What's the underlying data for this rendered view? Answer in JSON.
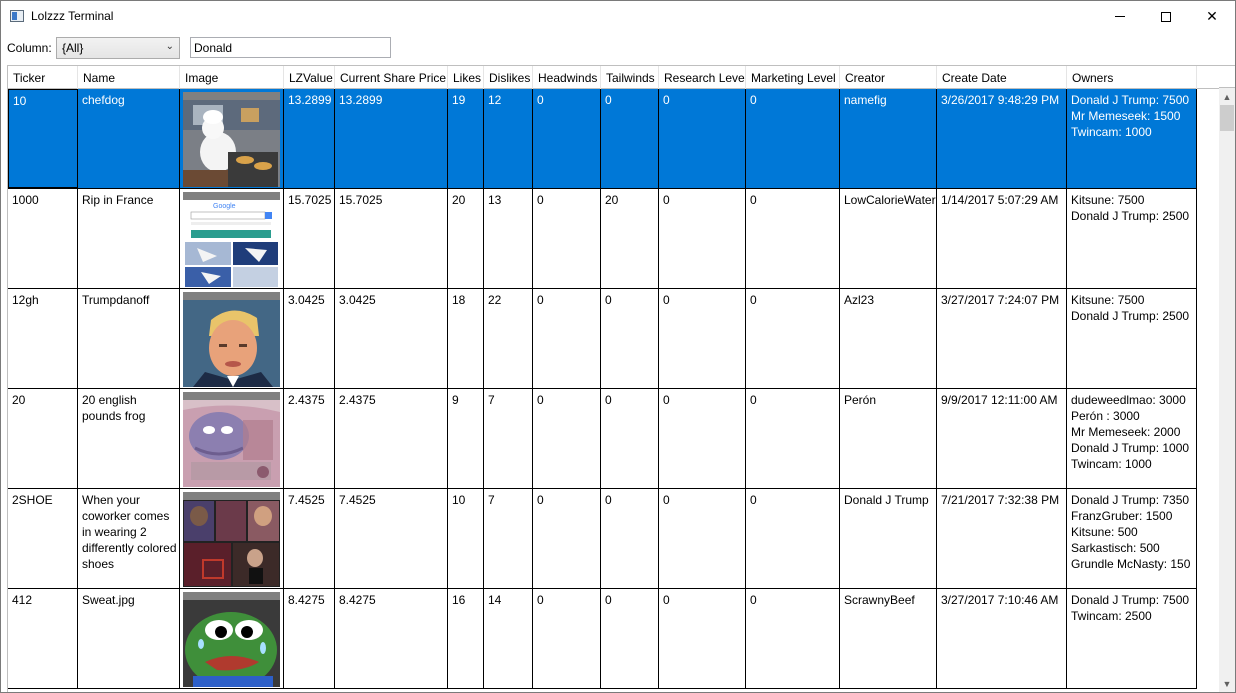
{
  "window": {
    "title": "Lolzzz Terminal"
  },
  "filter": {
    "column_label": "Column:",
    "column_value": "{All}",
    "search_value": "Donald"
  },
  "columns": [
    "Ticker",
    "Name",
    "Image",
    "LZValue",
    "Current Share Price",
    "Likes",
    "Dislikes",
    "Headwinds",
    "Tailwinds",
    "Research Level",
    "Marketing Level",
    "Creator",
    "Create Date",
    "Owners"
  ],
  "rows": [
    {
      "ticker": "10",
      "name": "chefdog",
      "image": "chef-dog-thumbnail",
      "lzvalue": "13.2899",
      "price": "13.2899",
      "likes": "19",
      "dislikes": "12",
      "headwinds": "0",
      "tailwinds": "0",
      "research": "0",
      "marketing": "0",
      "creator": "namefig",
      "date": "3/26/2017 9:48:29 PM",
      "owners": [
        "Donald J Trump: 7500",
        "Mr Memeseek: 1500",
        "Twincam: 1000"
      ]
    },
    {
      "ticker": "1000",
      "name": "Rip in France",
      "image": "google-search-thumbnail",
      "lzvalue": "15.7025",
      "price": "15.7025",
      "likes": "20",
      "dislikes": "13",
      "headwinds": "0",
      "tailwinds": "20",
      "research": "0",
      "marketing": "0",
      "creator": "LowCalorieWater",
      "date": "1/14/2017 5:07:29 AM",
      "owners": [
        "Kitsune: 7500",
        "Donald J Trump: 2500"
      ]
    },
    {
      "ticker": "12gh",
      "name": "Trumpdanoff",
      "image": "portrait-thumbnail",
      "lzvalue": "3.0425",
      "price": "3.0425",
      "likes": "18",
      "dislikes": "22",
      "headwinds": "0",
      "tailwinds": "0",
      "research": "0",
      "marketing": "0",
      "creator": "Azl23",
      "date": "3/27/2017 7:24:07 PM",
      "owners": [
        "Kitsune: 7500",
        "Donald J Trump: 2500"
      ]
    },
    {
      "ticker": "20",
      "name": "20 english pounds frog",
      "image": "banknote-frog-thumbnail",
      "lzvalue": "2.4375",
      "price": "2.4375",
      "likes": "9",
      "dislikes": "7",
      "headwinds": "0",
      "tailwinds": "0",
      "research": "0",
      "marketing": "0",
      "creator": "Perón",
      "date": "9/9/2017 12:11:00 AM",
      "owners": [
        "dudeweedlmao: 3000",
        "Perón : 3000",
        "Mr Memeseek: 2000",
        "Donald J Trump: 1000",
        "Twincam: 1000"
      ]
    },
    {
      "ticker": "2SHOE",
      "name": "When your coworker comes in wearing 2 differently colored shoes",
      "image": "collage-thumbnail",
      "lzvalue": "7.4525",
      "price": "7.4525",
      "likes": "10",
      "dislikes": "7",
      "headwinds": "0",
      "tailwinds": "0",
      "research": "0",
      "marketing": "0",
      "creator": "Donald J Trump",
      "date": "7/21/2017 7:32:38 PM",
      "owners": [
        "Donald J Trump: 7350",
        "FranzGruber: 1500",
        "Kitsune: 500",
        "Sarkastisch: 500",
        "Grundle McNasty: 150"
      ]
    },
    {
      "ticker": "412",
      "name": "Sweat.jpg",
      "image": "sweating-frog-thumbnail",
      "lzvalue": "8.4275",
      "price": "8.4275",
      "likes": "16",
      "dislikes": "14",
      "headwinds": "0",
      "tailwinds": "0",
      "research": "0",
      "marketing": "0",
      "creator": "ScrawnyBeef",
      "date": "3/27/2017 7:10:46 AM",
      "owners": [
        "Donald J Trump: 7500",
        "Twincam: 2500"
      ]
    }
  ],
  "colors": {
    "selection": "#0078d7",
    "grid_line": "#000000"
  }
}
